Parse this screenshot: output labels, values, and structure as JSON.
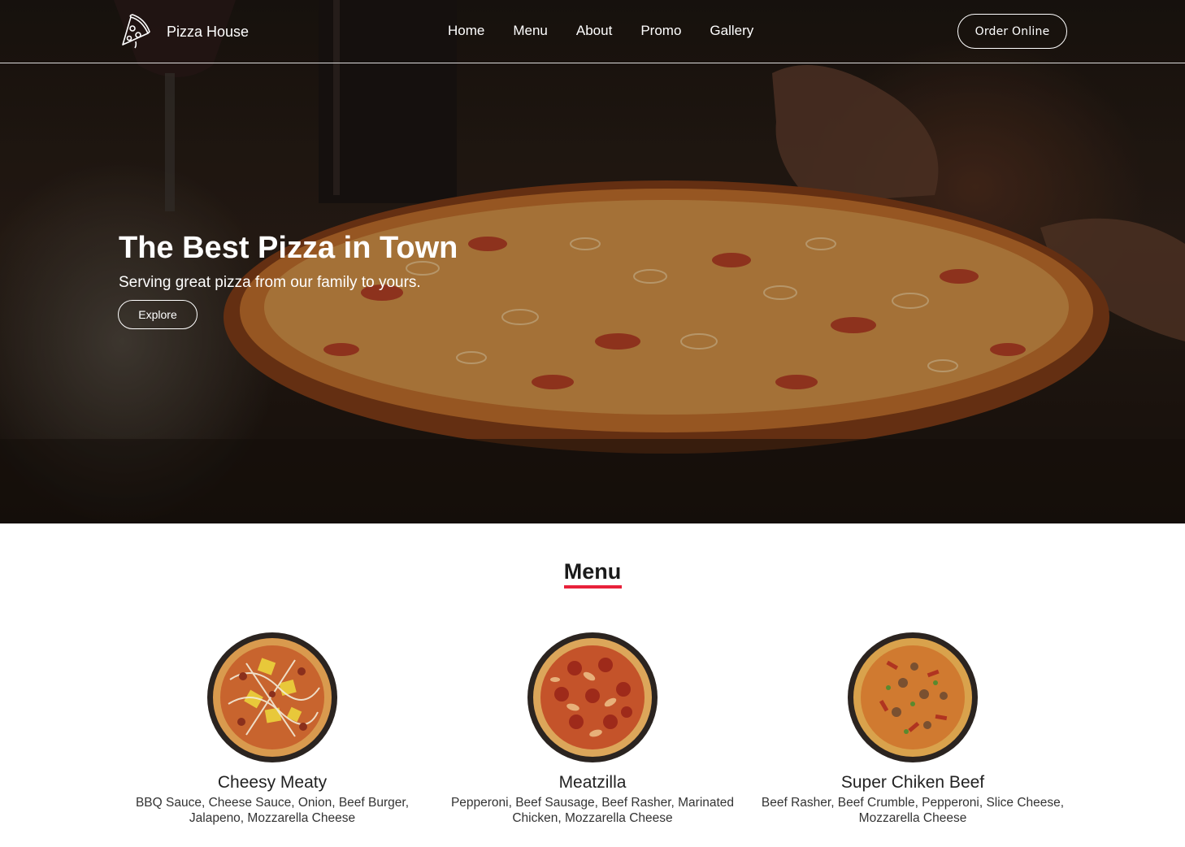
{
  "brand": {
    "name": "Pizza House",
    "logo_icon": "pizza-slice-icon"
  },
  "nav": {
    "links": [
      "Home",
      "Menu",
      "About",
      "Promo",
      "Gallery"
    ],
    "order_button": "Order Online"
  },
  "hero": {
    "title": "The Best Pizza in Town",
    "subtitle": "Serving great pizza from our family to yours.",
    "button": "Explore"
  },
  "menu": {
    "heading": "Menu",
    "accent_color": "#e8213a",
    "items": [
      {
        "name": "Cheesy Meaty",
        "description": "BBQ Sauce, Cheese Sauce, Onion, Beef Burger, Jalapeno, Mozzarella Cheese"
      },
      {
        "name": "Meatzilla",
        "description": "Pepperoni, Beef Sausage, Beef Rasher, Marinated Chicken, Mozzarella Cheese"
      },
      {
        "name": "Super Chiken Beef",
        "description": "Beef Rasher, Beef Crumble, Pepperoni, Slice Cheese, Mozzarella Cheese"
      }
    ]
  }
}
